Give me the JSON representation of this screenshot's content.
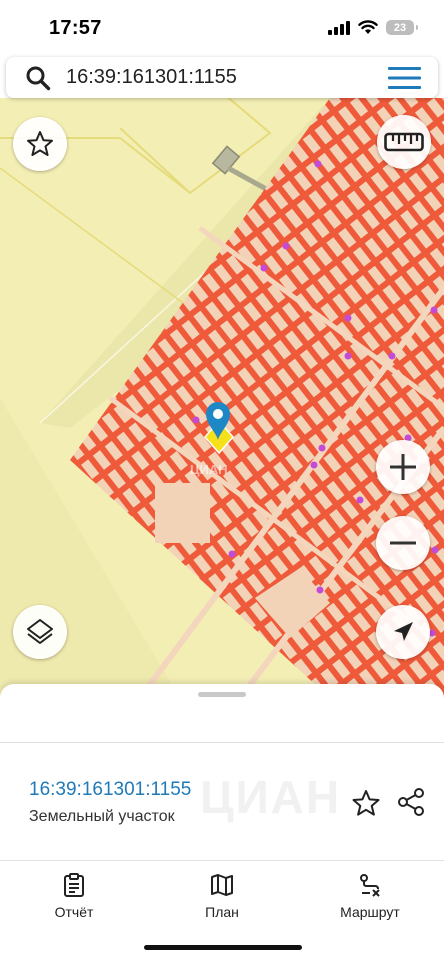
{
  "status_bar": {
    "time": "17:57",
    "battery_level": "23"
  },
  "search": {
    "query": "16:39:161301:1155",
    "icon": "search-icon",
    "menu_icon": "hamburger-menu-icon"
  },
  "map": {
    "watermark": "ЦИАН",
    "controls": {
      "favorite_icon": "star-outline-icon",
      "ruler_icon": "ruler-icon",
      "layers_icon": "layers-icon",
      "zoom_in_icon": "plus-icon",
      "zoom_out_icon": "minus-icon",
      "locate_icon": "navigation-arrow-icon"
    },
    "colors": {
      "land": "#f3eeb4",
      "parcel_fill": "#f3d3b8",
      "parcel_border": "#ee5536",
      "marker": "#1e88c7",
      "highlight": "#f5e01a"
    }
  },
  "sheet": {
    "cadastral_number": "16:39:161301:1155",
    "object_type": "Земельный участок",
    "watermark": "ЦИАН",
    "actions": {
      "favorite_icon": "star-outline-icon",
      "share_icon": "share-icon"
    }
  },
  "tabs": [
    {
      "label": "Отчёт",
      "icon": "clipboard-icon"
    },
    {
      "label": "План",
      "icon": "map-icon"
    },
    {
      "label": "Маршрут",
      "icon": "route-icon"
    }
  ]
}
